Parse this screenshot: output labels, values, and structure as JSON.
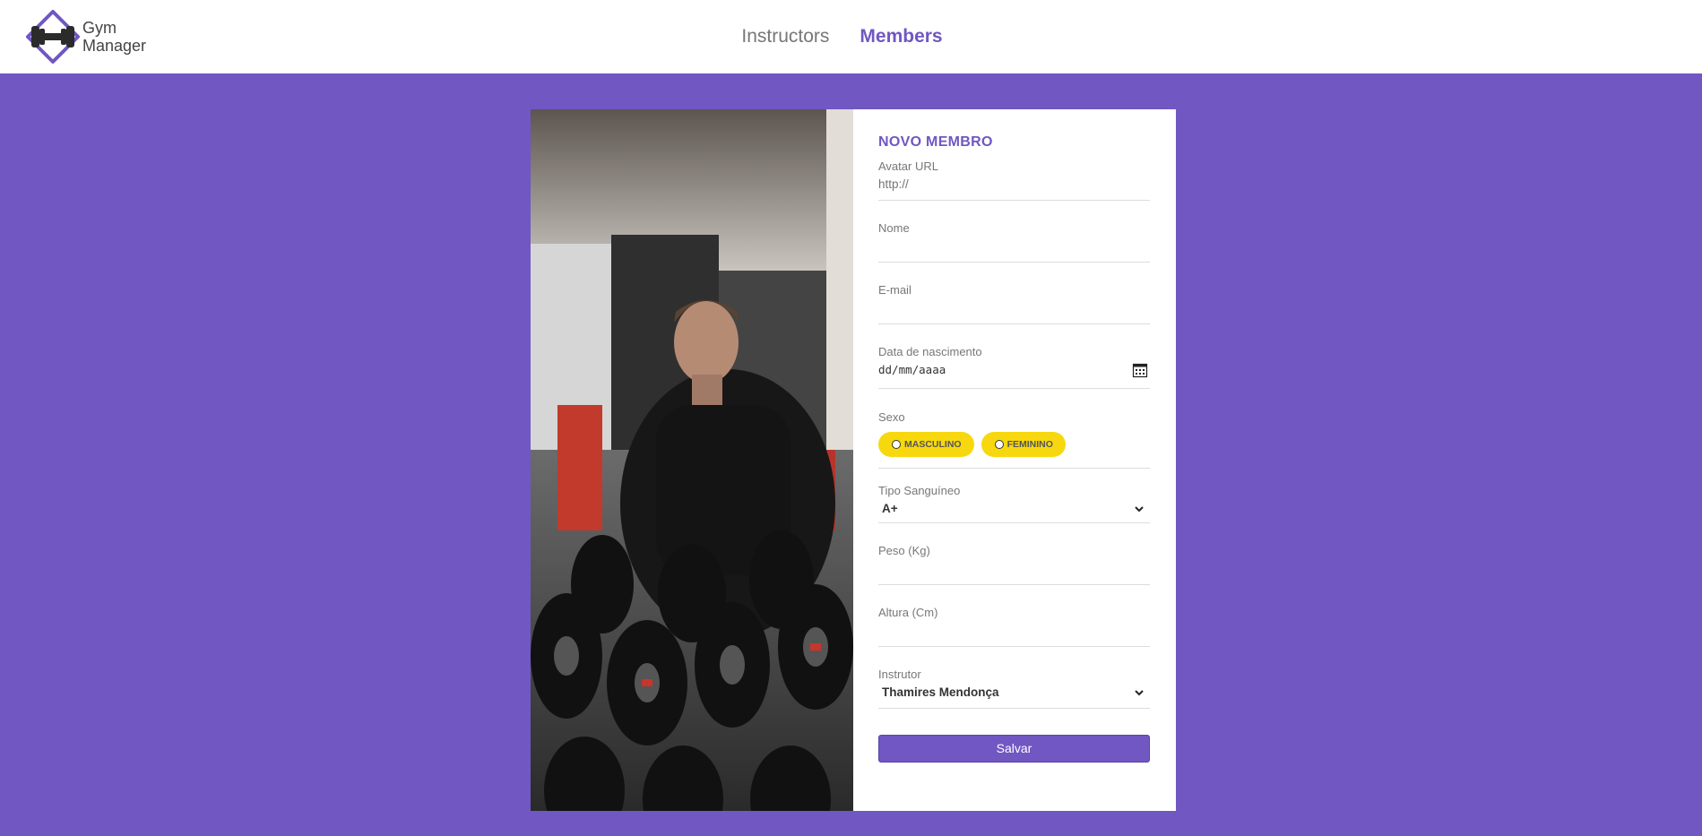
{
  "header": {
    "logo": {
      "line1": "Gym",
      "line2": "Manager"
    },
    "nav": [
      {
        "label": "Instructors",
        "active": false
      },
      {
        "label": "Members",
        "active": true
      }
    ]
  },
  "form": {
    "title": "NOVO MEMBRO",
    "avatar_url": {
      "label": "Avatar URL",
      "placeholder": "http://"
    },
    "nome": {
      "label": "Nome",
      "value": ""
    },
    "email": {
      "label": "E-mail",
      "value": ""
    },
    "nascimento": {
      "label": "Data de nascimento",
      "placeholder": "dd/mm/aaaa"
    },
    "sexo": {
      "label": "Sexo",
      "options": [
        "MASCULINO",
        "FEMININO"
      ]
    },
    "tipo_sanguineo": {
      "label": "Tipo Sanguíneo",
      "selected": "A+"
    },
    "peso": {
      "label": "Peso (Kg)",
      "value": ""
    },
    "altura": {
      "label": "Altura (Cm)",
      "value": ""
    },
    "instrutor": {
      "label": "Instrutor",
      "selected": "Thamires Mendonça"
    },
    "submit_label": "Salvar"
  },
  "colors": {
    "accent": "#7057c2",
    "pill": "#f7d80f",
    "background": "#7057c2"
  },
  "icons": [
    "dumbbell-logo-icon",
    "calendar-icon",
    "chevron-down-icon"
  ]
}
